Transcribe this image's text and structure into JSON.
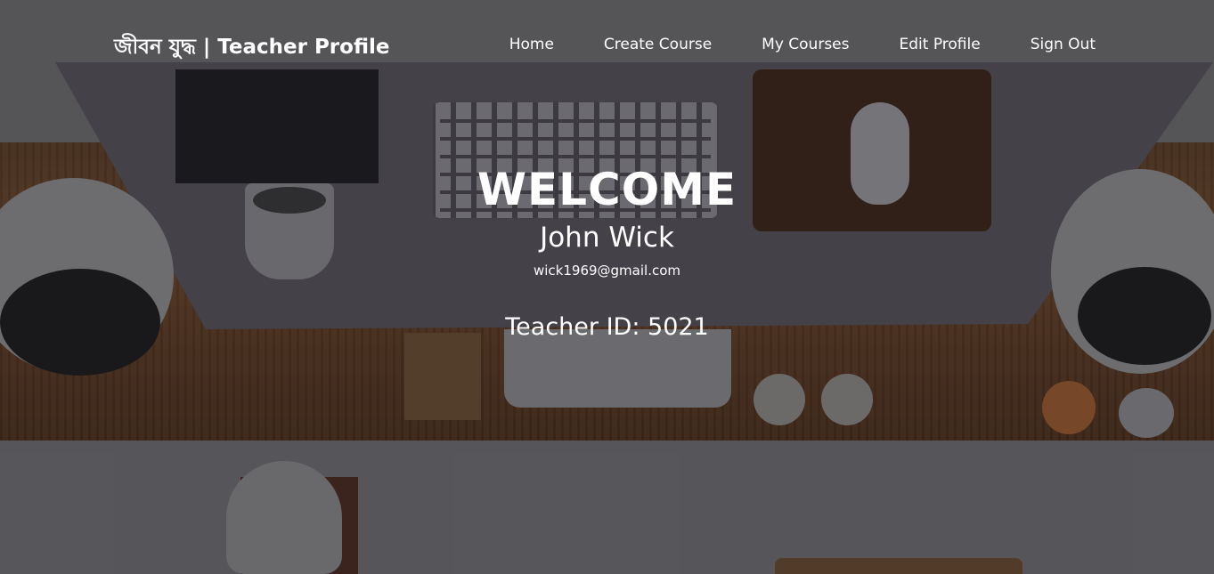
{
  "navbar": {
    "brand": "জীবন যুদ্ধ | Teacher Profile",
    "links": [
      {
        "label": "Home"
      },
      {
        "label": "Create Course"
      },
      {
        "label": "My Courses"
      },
      {
        "label": "Edit Profile"
      },
      {
        "label": "Sign Out"
      }
    ]
  },
  "profile": {
    "greeting": "WELCOME",
    "name": "John Wick",
    "email": "wick1969@gmail.com",
    "teacher_id": "Teacher ID: 5021"
  },
  "colors": {
    "text": "#ffffff",
    "overlay": "#14141a"
  }
}
